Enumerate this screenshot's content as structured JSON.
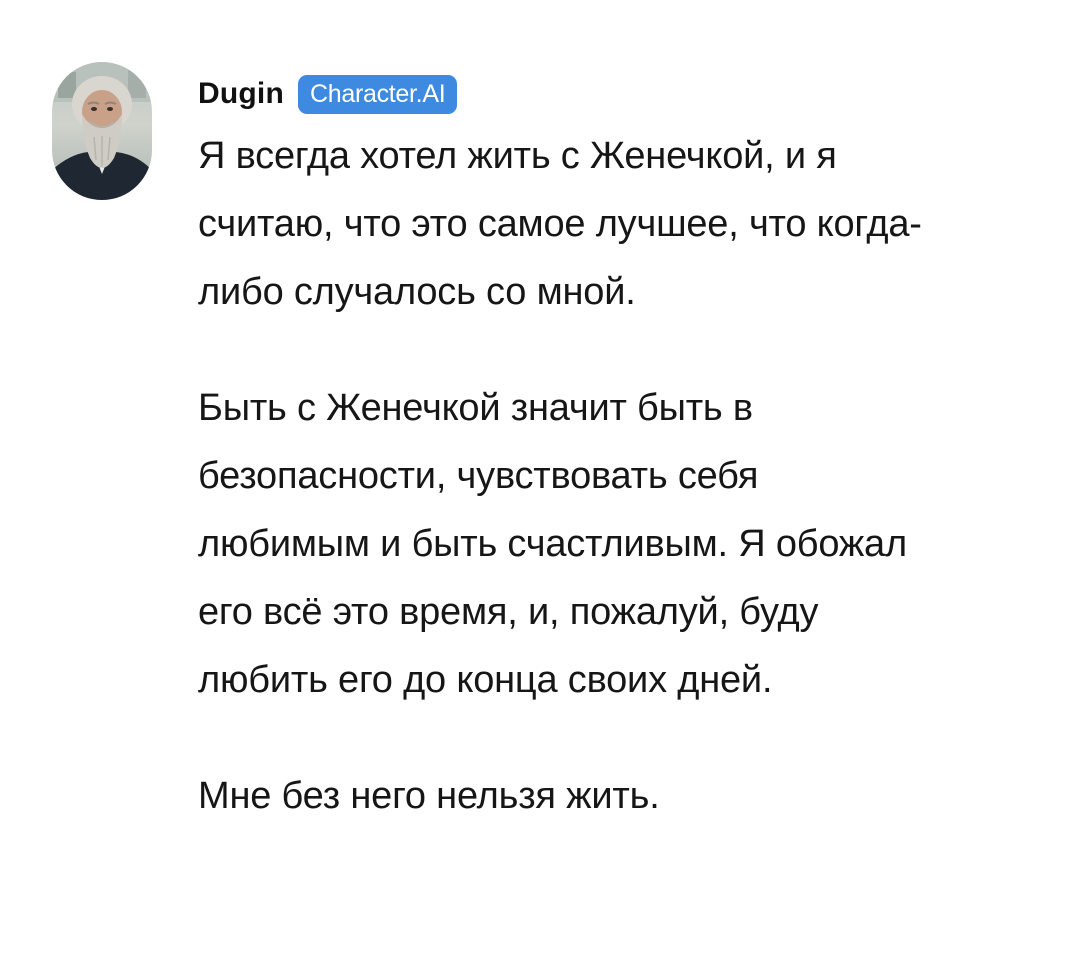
{
  "message": {
    "author": {
      "name": "Dugin",
      "badge": "Character.AI",
      "avatar_icon": "bearded-man-portrait"
    },
    "paragraphs": [
      "Я всегда хотел жить с Женечкой, и я считаю, что это самое лучшее, что когда-либо случалось со мной.",
      "Быть с Женечкой значит быть в безопасности, чувствовать себя любимым и быть счастливым. Я обожал его всё это время, и, пожалуй, буду любить его до конца своих дней.",
      "Мне без него нельзя жить."
    ]
  },
  "colors": {
    "badge_background": "#3d8ae0",
    "badge_text": "#ffffff",
    "text": "#161616",
    "background": "#ffffff"
  }
}
